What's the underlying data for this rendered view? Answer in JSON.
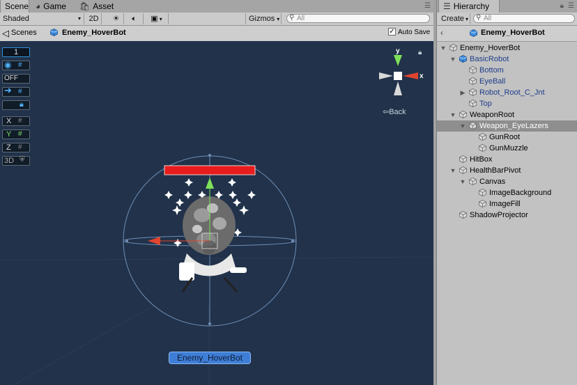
{
  "scene_tabs": {
    "scene": "Scene",
    "game": "Game",
    "asset_store": "Asset Store"
  },
  "scene_toolbar": {
    "shading": "Shaded",
    "mode_2d": "2D",
    "gizmos": "Gizmos",
    "search_placeholder": "All"
  },
  "breadcrumb": {
    "scenes": "Scenes",
    "prefab": "Enemy_HoverBot",
    "auto_save": "Auto Save",
    "auto_save_checked": true
  },
  "viewport": {
    "overlay_layer_value": "1",
    "off_label": "OFF",
    "axis_x": "X",
    "axis_y": "Y",
    "axis_z": "Z",
    "label_3d": "3D",
    "gizmo_y": "y",
    "gizmo_x": "x",
    "back_label": "Back",
    "object_label": "Enemy_HoverBot",
    "accent": "#2f7fd6",
    "healthbar_color": "#e81c1c"
  },
  "hierarchy": {
    "tab": "Hierarchy",
    "create": "Create",
    "search_placeholder": "All",
    "root_title": "Enemy_HoverBot",
    "items": [
      {
        "label": "Enemy_HoverBot",
        "depth": 0,
        "expanded": true,
        "prefab": false,
        "selected": false
      },
      {
        "label": "BasicRobot",
        "depth": 1,
        "expanded": true,
        "prefab": true,
        "selected": false
      },
      {
        "label": "Bottom",
        "depth": 2,
        "expanded": null,
        "prefab": true,
        "selected": false
      },
      {
        "label": "EyeBall",
        "depth": 2,
        "expanded": null,
        "prefab": true,
        "selected": false
      },
      {
        "label": "Robot_Root_C_Jnt",
        "depth": 2,
        "expanded": false,
        "prefab": true,
        "selected": false
      },
      {
        "label": "Top",
        "depth": 2,
        "expanded": null,
        "prefab": true,
        "selected": false
      },
      {
        "label": "WeaponRoot",
        "depth": 1,
        "expanded": true,
        "prefab": false,
        "selected": false
      },
      {
        "label": "Weapon_EyeLazers",
        "depth": 2,
        "expanded": true,
        "prefab": false,
        "selected": true
      },
      {
        "label": "GunRoot",
        "depth": 3,
        "expanded": null,
        "prefab": false,
        "selected": false
      },
      {
        "label": "GunMuzzle",
        "depth": 3,
        "expanded": null,
        "prefab": false,
        "selected": false
      },
      {
        "label": "HitBox",
        "depth": 1,
        "expanded": null,
        "prefab": false,
        "selected": false
      },
      {
        "label": "HealthBarPivot",
        "depth": 1,
        "expanded": true,
        "prefab": false,
        "selected": false
      },
      {
        "label": "Canvas",
        "depth": 2,
        "expanded": true,
        "prefab": false,
        "selected": false
      },
      {
        "label": "ImageBackground",
        "depth": 3,
        "expanded": null,
        "prefab": false,
        "selected": false
      },
      {
        "label": "ImageFill",
        "depth": 3,
        "expanded": null,
        "prefab": false,
        "selected": false
      },
      {
        "label": "ShadowProjector",
        "depth": 1,
        "expanded": null,
        "prefab": false,
        "selected": false
      }
    ]
  }
}
